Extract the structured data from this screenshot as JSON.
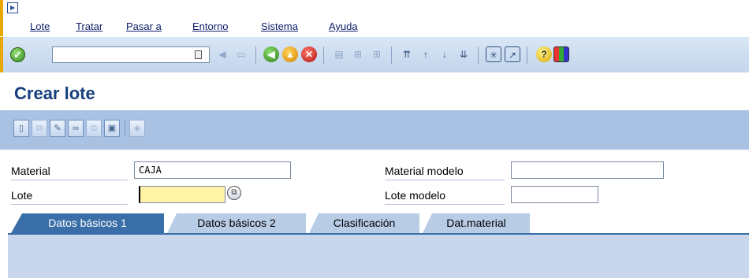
{
  "menu": {
    "items": [
      {
        "label": "Lote"
      },
      {
        "label": "Tratar"
      },
      {
        "label": "Pasar a"
      },
      {
        "label": "Entorno"
      },
      {
        "label": "Sistema"
      },
      {
        "label": "Ayuda"
      }
    ]
  },
  "toolbar": {
    "command_field_value": "",
    "icons": [
      "enter-icon",
      "back-icon",
      "save-icon",
      "back-green-icon",
      "exit-icon",
      "cancel-icon",
      "print-icon",
      "find-icon",
      "find-next-icon",
      "first-page-icon",
      "previous-page-icon",
      "next-page-icon",
      "last-page-icon",
      "create-session-icon",
      "shortcut-icon",
      "help-icon",
      "customize-layout-icon"
    ]
  },
  "title": "Crear lote",
  "app_toolbar": {
    "icons": [
      "create-icon",
      "copy-icon",
      "change-icon",
      "display-icon",
      "classification-icon",
      "document-icon",
      "print-icon"
    ]
  },
  "form": {
    "material_label": "Material",
    "material_value": "CAJA",
    "lote_label": "Lote",
    "lote_value": "",
    "material_modelo_label": "Material modelo",
    "material_modelo_value": "",
    "lote_modelo_label": "Lote modelo",
    "lote_modelo_value": ""
  },
  "tabs": [
    {
      "label": "Datos básicos 1",
      "active": true
    },
    {
      "label": "Datos básicos 2",
      "active": false
    },
    {
      "label": "Clasificación",
      "active": false
    },
    {
      "label": "Dat.material",
      "active": false
    }
  ],
  "colors": {
    "title": "#153e7e",
    "accent": "#3a6ea8",
    "required_field": "#fff3a6"
  }
}
